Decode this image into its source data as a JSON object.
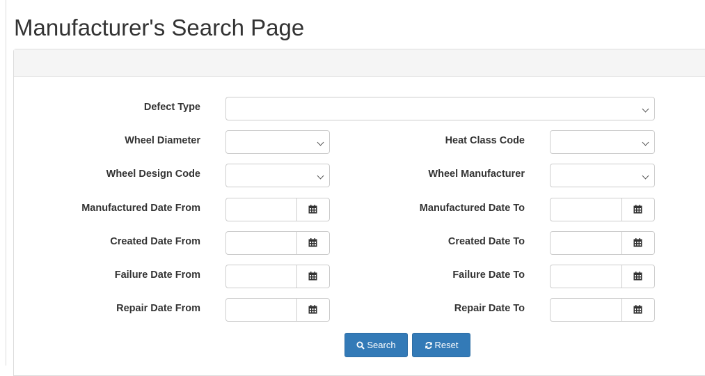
{
  "page": {
    "title": "Manufacturer's Search Page"
  },
  "form": {
    "defect_type": {
      "label": "Defect Type",
      "value": ""
    },
    "wheel_diameter": {
      "label": "Wheel Diameter",
      "value": ""
    },
    "heat_class_code": {
      "label": "Heat Class Code",
      "value": ""
    },
    "wheel_design_code": {
      "label": "Wheel Design Code",
      "value": ""
    },
    "wheel_manufacturer": {
      "label": "Wheel Manufacturer",
      "value": ""
    },
    "manufactured_date_from": {
      "label": "Manufactured Date From",
      "value": ""
    },
    "manufactured_date_to": {
      "label": "Manufactured Date To",
      "value": ""
    },
    "created_date_from": {
      "label": "Created Date From",
      "value": ""
    },
    "created_date_to": {
      "label": "Created Date To",
      "value": ""
    },
    "failure_date_from": {
      "label": "Failure Date From",
      "value": ""
    },
    "failure_date_to": {
      "label": "Failure Date To",
      "value": ""
    },
    "repair_date_from": {
      "label": "Repair Date From",
      "value": ""
    },
    "repair_date_to": {
      "label": "Repair Date To",
      "value": ""
    }
  },
  "buttons": {
    "search": {
      "label": "Search",
      "icon": "search-icon"
    },
    "reset": {
      "label": "Reset",
      "icon": "refresh-icon"
    }
  },
  "colors": {
    "primary": "#337ab7",
    "border": "#cccccc",
    "panel_heading": "#f5f5f5"
  },
  "icons": {
    "date_addon": "calendar-icon",
    "select_arrow": "chevron-down-icon"
  }
}
